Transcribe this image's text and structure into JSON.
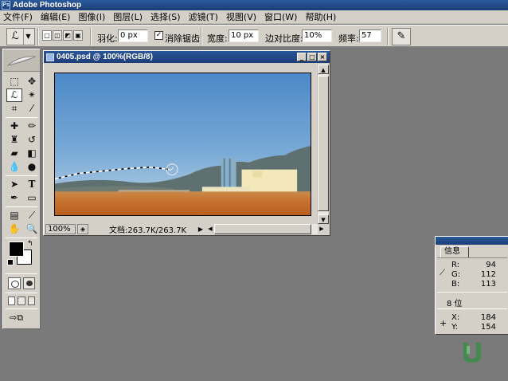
{
  "app": {
    "title": "Adobe Photoshop",
    "icon": "ps-icon"
  },
  "menu": [
    "文件(F)",
    "编辑(E)",
    "图像(I)",
    "图层(L)",
    "选择(S)",
    "滤镜(T)",
    "视图(V)",
    "窗口(W)",
    "帮助(H)"
  ],
  "options": {
    "feather_label": "羽化:",
    "feather_value": "0 px",
    "antialias_label": "消除锯齿",
    "antialias_checked": "✓",
    "width_label": "宽度:",
    "width_value": "10 px",
    "edge_contrast_label": "边对比度:",
    "edge_contrast_value": "10%",
    "frequency_label": "频率:",
    "frequency_value": "57"
  },
  "document": {
    "title": "0405.psd @ 100%(RGB/8)",
    "zoom": "100%",
    "doc_info": "文档:263.7K/263.7K"
  },
  "info_panel": {
    "tab": "信息",
    "r_label": "R:",
    "r_value": "94",
    "g_label": "G:",
    "g_value": "112",
    "b_label": "B:",
    "b_value": "113",
    "bit_depth": "8 位",
    "x_label": "X:",
    "x_value": "184",
    "y_label": "Y:",
    "y_value": "154"
  },
  "colors": {
    "foreground": "#000000",
    "background": "#ffffff",
    "title_bar": "#1b3d75",
    "workspace": "#7a7a7a"
  }
}
